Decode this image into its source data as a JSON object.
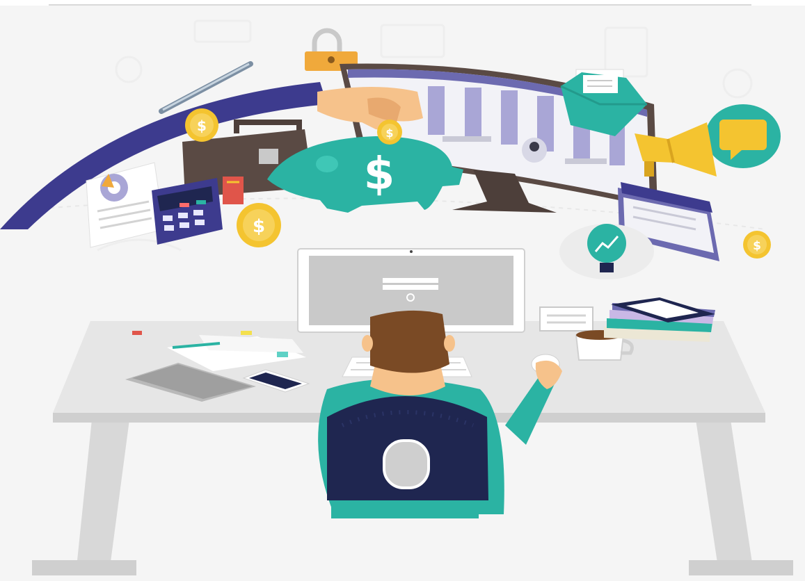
{
  "illustration": {
    "subject": "office-worker-at-desk-finance-icons",
    "coin_symbol": "$",
    "piggy_bank_symbol": "$",
    "colors": {
      "background": "#f5f5f5",
      "teal": "#2bb3a3",
      "navy": "#1f2650",
      "indigo_arc": "#3d3b8e",
      "gold": "#f4c430",
      "desk": "#e6e6e6",
      "skin": "#f6c28b",
      "hair": "#7a4a25",
      "monitor_frame": "#5a4a44",
      "chart_bars": "#a9a6d6"
    },
    "icons": [
      "padlock-icon",
      "pencil-icon",
      "coin-icon",
      "briefcase-icon",
      "piggy-bank-icon",
      "calculator-icon",
      "document-chart-icon",
      "monitor-dashboard-icon",
      "envelope-icon",
      "megaphone-icon",
      "chat-bubble-icon",
      "lightbulb-growth-icon",
      "calendar-icon",
      "coffee-mug-icon",
      "books-stack-icon",
      "smartphone-icon",
      "tablet-icon",
      "keyboard-icon",
      "mouse-icon"
    ]
  }
}
